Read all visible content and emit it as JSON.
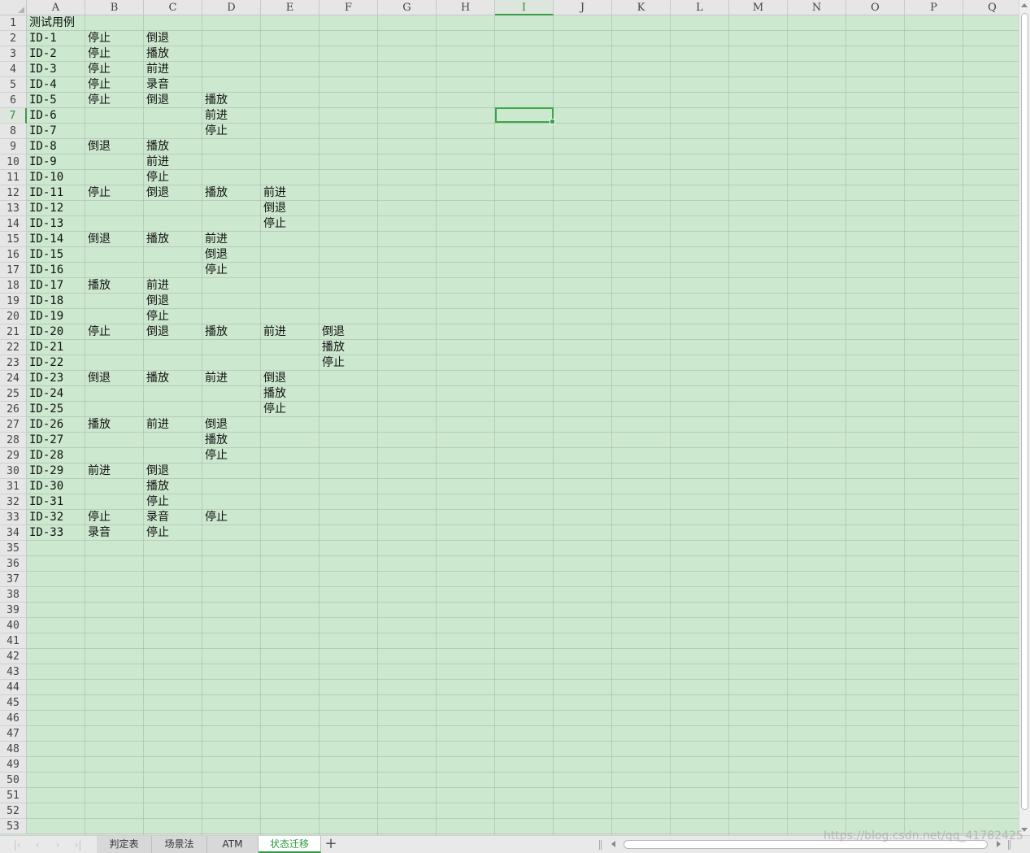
{
  "columns": [
    "A",
    "B",
    "C",
    "D",
    "E",
    "F",
    "G",
    "H",
    "I",
    "J",
    "K",
    "L",
    "M",
    "N",
    "O",
    "P",
    "Q"
  ],
  "active_column": "I",
  "row_count": 53,
  "active_row": 7,
  "selected_cell": "I7",
  "cells": [
    {
      "ref": "A1",
      "value": "测试用例"
    },
    {
      "ref": "A2",
      "value": "ID-1"
    },
    {
      "ref": "B2",
      "value": "停止"
    },
    {
      "ref": "C2",
      "value": "倒退"
    },
    {
      "ref": "A3",
      "value": "ID-2"
    },
    {
      "ref": "B3",
      "value": "停止"
    },
    {
      "ref": "C3",
      "value": "播放"
    },
    {
      "ref": "A4",
      "value": "ID-3"
    },
    {
      "ref": "B4",
      "value": "停止"
    },
    {
      "ref": "C4",
      "value": "前进"
    },
    {
      "ref": "A5",
      "value": "ID-4"
    },
    {
      "ref": "B5",
      "value": "停止"
    },
    {
      "ref": "C5",
      "value": "录音"
    },
    {
      "ref": "A6",
      "value": "ID-5"
    },
    {
      "ref": "B6",
      "value": "停止"
    },
    {
      "ref": "C6",
      "value": "倒退"
    },
    {
      "ref": "D6",
      "value": "播放"
    },
    {
      "ref": "A7",
      "value": "ID-6"
    },
    {
      "ref": "D7",
      "value": "前进"
    },
    {
      "ref": "A8",
      "value": "ID-7"
    },
    {
      "ref": "D8",
      "value": "停止"
    },
    {
      "ref": "A9",
      "value": "ID-8"
    },
    {
      "ref": "B9",
      "value": "倒退"
    },
    {
      "ref": "C9",
      "value": "播放"
    },
    {
      "ref": "A10",
      "value": "ID-9"
    },
    {
      "ref": "C10",
      "value": "前进"
    },
    {
      "ref": "A11",
      "value": "ID-10"
    },
    {
      "ref": "C11",
      "value": "停止"
    },
    {
      "ref": "A12",
      "value": "ID-11"
    },
    {
      "ref": "B12",
      "value": "停止"
    },
    {
      "ref": "C12",
      "value": "倒退"
    },
    {
      "ref": "D12",
      "value": "播放"
    },
    {
      "ref": "E12",
      "value": "前进"
    },
    {
      "ref": "A13",
      "value": "ID-12"
    },
    {
      "ref": "E13",
      "value": "倒退"
    },
    {
      "ref": "A14",
      "value": "ID-13"
    },
    {
      "ref": "E14",
      "value": "停止"
    },
    {
      "ref": "A15",
      "value": "ID-14"
    },
    {
      "ref": "B15",
      "value": "倒退"
    },
    {
      "ref": "C15",
      "value": "播放"
    },
    {
      "ref": "D15",
      "value": "前进"
    },
    {
      "ref": "A16",
      "value": "ID-15"
    },
    {
      "ref": "D16",
      "value": "倒退"
    },
    {
      "ref": "A17",
      "value": "ID-16"
    },
    {
      "ref": "D17",
      "value": "停止"
    },
    {
      "ref": "A18",
      "value": "ID-17"
    },
    {
      "ref": "B18",
      "value": "播放"
    },
    {
      "ref": "C18",
      "value": "前进"
    },
    {
      "ref": "A19",
      "value": "ID-18"
    },
    {
      "ref": "C19",
      "value": "倒退"
    },
    {
      "ref": "A20",
      "value": "ID-19"
    },
    {
      "ref": "C20",
      "value": "停止"
    },
    {
      "ref": "A21",
      "value": "ID-20"
    },
    {
      "ref": "B21",
      "value": "停止"
    },
    {
      "ref": "C21",
      "value": "倒退"
    },
    {
      "ref": "D21",
      "value": "播放"
    },
    {
      "ref": "E21",
      "value": "前进"
    },
    {
      "ref": "F21",
      "value": "倒退"
    },
    {
      "ref": "A22",
      "value": "ID-21"
    },
    {
      "ref": "F22",
      "value": "播放"
    },
    {
      "ref": "A23",
      "value": "ID-22"
    },
    {
      "ref": "F23",
      "value": "停止"
    },
    {
      "ref": "A24",
      "value": "ID-23"
    },
    {
      "ref": "B24",
      "value": "倒退"
    },
    {
      "ref": "C24",
      "value": "播放"
    },
    {
      "ref": "D24",
      "value": "前进"
    },
    {
      "ref": "E24",
      "value": "倒退"
    },
    {
      "ref": "A25",
      "value": "ID-24"
    },
    {
      "ref": "E25",
      "value": "播放"
    },
    {
      "ref": "A26",
      "value": "ID-25"
    },
    {
      "ref": "E26",
      "value": "停止"
    },
    {
      "ref": "A27",
      "value": "ID-26"
    },
    {
      "ref": "B27",
      "value": "播放"
    },
    {
      "ref": "C27",
      "value": "前进"
    },
    {
      "ref": "D27",
      "value": "倒退"
    },
    {
      "ref": "A28",
      "value": "ID-27"
    },
    {
      "ref": "D28",
      "value": "播放"
    },
    {
      "ref": "A29",
      "value": "ID-28"
    },
    {
      "ref": "D29",
      "value": "停止"
    },
    {
      "ref": "A30",
      "value": "ID-29"
    },
    {
      "ref": "B30",
      "value": "前进"
    },
    {
      "ref": "C30",
      "value": "倒退"
    },
    {
      "ref": "A31",
      "value": "ID-30"
    },
    {
      "ref": "C31",
      "value": "播放"
    },
    {
      "ref": "A32",
      "value": "ID-31"
    },
    {
      "ref": "C32",
      "value": "停止"
    },
    {
      "ref": "A33",
      "value": "ID-32"
    },
    {
      "ref": "B33",
      "value": "停止"
    },
    {
      "ref": "C33",
      "value": "录音"
    },
    {
      "ref": "D33",
      "value": "停止"
    },
    {
      "ref": "A34",
      "value": "ID-33"
    },
    {
      "ref": "B34",
      "value": "录音"
    },
    {
      "ref": "C34",
      "value": "停止"
    }
  ],
  "sheet_tabs": [
    {
      "label": "判定表",
      "active": false
    },
    {
      "label": "场景法",
      "active": false
    },
    {
      "label": "ATM",
      "active": false
    },
    {
      "label": "状态迁移",
      "active": true
    }
  ],
  "add_sheet_label": "+",
  "nav_buttons": [
    {
      "name": "first-sheet-icon",
      "glyph": "|‹"
    },
    {
      "name": "prev-sheet-icon",
      "glyph": "‹"
    },
    {
      "name": "next-sheet-icon",
      "glyph": "›"
    },
    {
      "name": "last-sheet-icon",
      "glyph": "›|"
    }
  ],
  "watermark": "https://blog.csdn.net/qq_41782425",
  "colors": {
    "grid_background": "#cce8cf",
    "selection": "#3aa64b",
    "active_tab_text": "#2f9a3d"
  }
}
